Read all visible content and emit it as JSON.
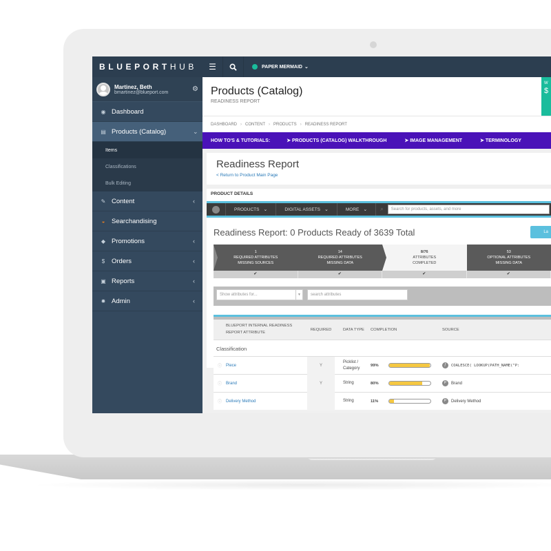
{
  "app": {
    "brand_bold": "BLUEPORT",
    "brand_light": "HUB"
  },
  "user": {
    "name": "Martinez, Beth",
    "email": "bmartinez@blueport.com"
  },
  "sidebar": {
    "items": [
      {
        "label": "Dashboard",
        "icon": "dashboard-icon",
        "glyph": "◉",
        "chevron": ""
      },
      {
        "label": "Products (Catalog)",
        "icon": "list-icon",
        "glyph": "▤",
        "chevron": "⌄"
      },
      {
        "label": "Content",
        "icon": "edit-icon",
        "glyph": "✎",
        "chevron": "‹"
      },
      {
        "label": "Searchandising",
        "icon": "searchandising-icon",
        "glyph": "◒",
        "chevron": ""
      },
      {
        "label": "Promotions",
        "icon": "tag-icon",
        "glyph": "◆",
        "chevron": "‹"
      },
      {
        "label": "Orders",
        "icon": "dollar-icon",
        "glyph": "$",
        "chevron": "‹"
      },
      {
        "label": "Reports",
        "icon": "image-icon",
        "glyph": "▣",
        "chevron": "‹"
      },
      {
        "label": "Admin",
        "icon": "gear-icon",
        "glyph": "✹",
        "chevron": "‹"
      }
    ],
    "subitems": [
      {
        "label": "Items"
      },
      {
        "label": "Classifications"
      },
      {
        "label": "Bulk Editing"
      }
    ]
  },
  "topbar": {
    "org_name": "PAPER MERMAID",
    "org_chevron": "⌄"
  },
  "header": {
    "title": "Products (Catalog)",
    "subtitle": "READINESS REPORT",
    "widget_letter": "W",
    "widget_symbol": "$"
  },
  "breadcrumb": [
    "DASHBOARD",
    "CONTENT",
    "PRODUCTS",
    "READINESS REPORT"
  ],
  "tutorials": {
    "label": "HOW TO'S & TUTORIALS:",
    "links": [
      "➤ PRODUCTS (CATALOG) WALKTHROUGH",
      "➤ IMAGE MANAGEMENT",
      "➤ TERMINOLOGY"
    ]
  },
  "report": {
    "title": "Readiness Report",
    "back_link": "< Return to Product Main Page",
    "section_label": "PRODUCT DETAILS",
    "summary": "Readiness Report: 0 Products Ready of 3639 Total",
    "launch_label": "La"
  },
  "pd_nav": {
    "menus": [
      {
        "label": "PRODUCTS"
      },
      {
        "label": "DIGITAL ASSETS"
      },
      {
        "label": "MORE"
      }
    ],
    "search_placeholder": "Search for products, assets, and more"
  },
  "steps": [
    {
      "count": "1",
      "line1": "REQUIRED ATTRIBUTES",
      "line2": "MISSING SOURCES",
      "check": "✔"
    },
    {
      "count": "14",
      "line1": "REQUIRED ATTRIBUTES",
      "line2": "MISSING DATA",
      "check": "✔"
    },
    {
      "count": "8/76",
      "line1": "ATTRIBUTES",
      "line2": "COMPLETED",
      "check": "✔"
    },
    {
      "count": "53",
      "line1": "OPTIONAL ATTRIBUTES",
      "line2": "MISSING DATA",
      "check": "✔"
    }
  ],
  "filters": {
    "select_placeholder": "Show attributes for...",
    "search_placeholder": "search attributes"
  },
  "table": {
    "headers": {
      "attribute_line1": "BLUEPORT INTERNAL READINESS",
      "attribute_line2": "REPORT ATTRIBUTE",
      "required": "REQUIRED",
      "data_type": "DATA TYPE",
      "completion": "COMPLETION",
      "source": "SOURCE"
    },
    "group": "Classification",
    "rows": [
      {
        "name": "Piece",
        "required": "Y",
        "data_type_1": "Picklist /",
        "data_type_2": "Category",
        "completion_label": "99%",
        "completion": 99,
        "source": "COALESCE( LOOKUP(PATH_NAME(\"P:",
        "source_mono": true
      },
      {
        "name": "Brand",
        "required": "Y",
        "data_type_1": "String",
        "data_type_2": "",
        "completion_label": "80%",
        "completion": 80,
        "source": "Brand",
        "source_mono": false
      },
      {
        "name": "Delivery Method",
        "required": "",
        "data_type_1": "String",
        "data_type_2": "",
        "completion_label": "11%",
        "completion": 11,
        "source": "Delivery Method",
        "source_mono": false
      }
    ]
  }
}
